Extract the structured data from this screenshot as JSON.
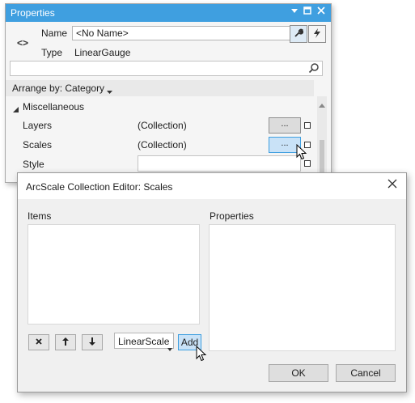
{
  "properties_panel": {
    "title": "Properties",
    "name_label": "Name",
    "name_value": "<No Name>",
    "type_label": "Type",
    "type_value": "LinearGauge",
    "search_placeholder": "",
    "arrange_label": "Arrange by: Category",
    "category": "Miscellaneous",
    "rows": [
      {
        "name": "Layers",
        "value": "(Collection)",
        "button": "..."
      },
      {
        "name": "Scales",
        "value": "(Collection)",
        "button": "..."
      },
      {
        "name": "Style",
        "value": ""
      }
    ]
  },
  "dialog": {
    "title": "ArcScale Collection Editor: Scales",
    "items_label": "Items",
    "properties_label": "Properties",
    "type_selected": "LinearScale",
    "add_label": "Add",
    "ok_label": "OK",
    "cancel_label": "Cancel"
  },
  "colors": {
    "title_bar": "#3f9fe0",
    "accent_button": "#c9e2f7"
  }
}
